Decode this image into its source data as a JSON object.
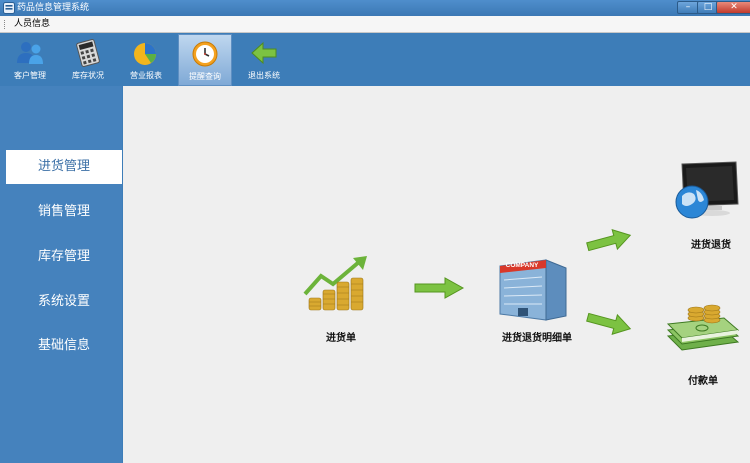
{
  "window": {
    "title": "药品信息管理系统",
    "min": "–",
    "max": "□",
    "close": "✕"
  },
  "menu": {
    "items": [
      {
        "label": "人员信息"
      }
    ]
  },
  "toolbar": {
    "items": [
      {
        "label": "客户管理",
        "icon": "users-icon"
      },
      {
        "label": "库存状况",
        "icon": "calculator-icon"
      },
      {
        "label": "营业报表",
        "icon": "pie-chart-icon"
      },
      {
        "label": "提醒查询",
        "icon": "clock-icon",
        "active": true
      },
      {
        "label": "退出系统",
        "icon": "exit-arrow-icon"
      }
    ]
  },
  "sidebar": {
    "items": [
      {
        "label": "进货管理",
        "active": true
      },
      {
        "label": "销售管理"
      },
      {
        "label": "库存管理"
      },
      {
        "label": "系统设置"
      },
      {
        "label": "基础信息"
      }
    ]
  },
  "flow": {
    "purchase_order": "进货单",
    "return_detail": "进货退货明细单",
    "purchase_return": "进货退货",
    "payment_order": "付款单",
    "company_sign": "COMPANY"
  },
  "colors": {
    "accent": "#3d7db8",
    "arrow": "#7cc242",
    "coin": "#d9a930"
  }
}
